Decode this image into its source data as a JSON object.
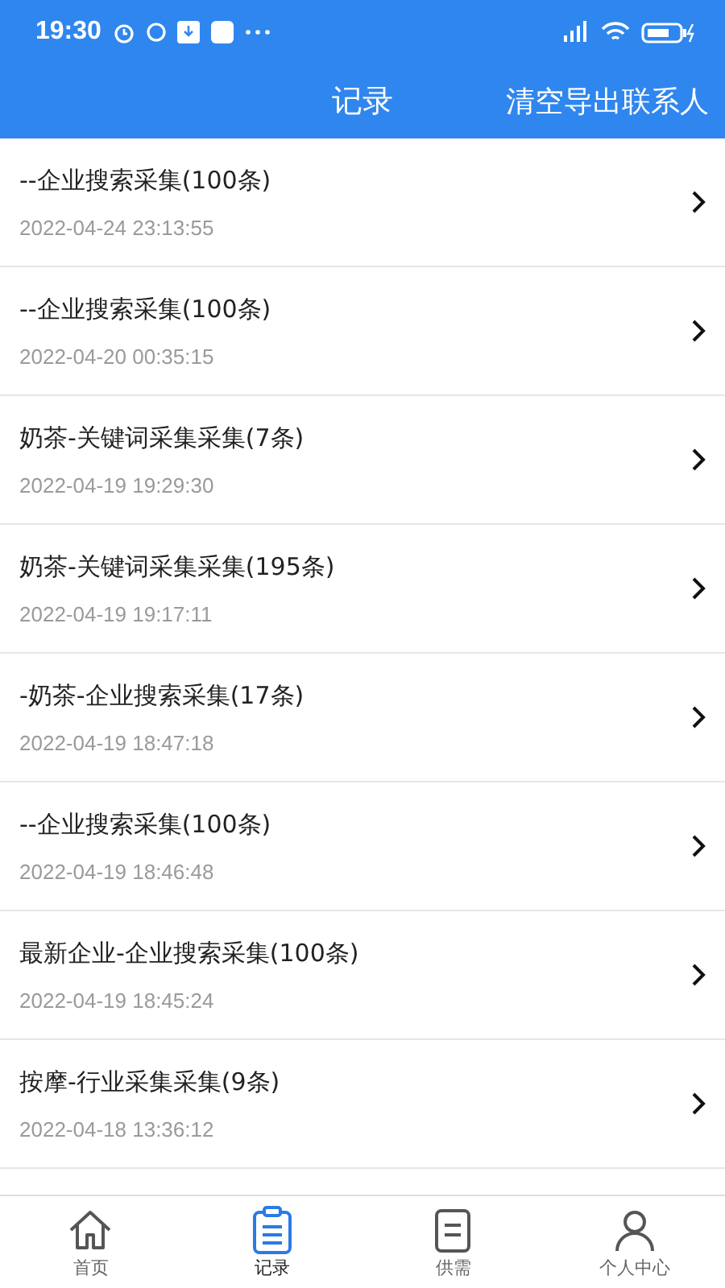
{
  "status_bar": {
    "time": "19:30"
  },
  "header": {
    "title": "记录",
    "action": "清空导出联系人"
  },
  "records": [
    {
      "title": "--企业搜索采集(100条)",
      "time": "2022-04-24 23:13:55"
    },
    {
      "title": "--企业搜索采集(100条)",
      "time": "2022-04-20 00:35:15"
    },
    {
      "title": "奶茶-关键词采集采集(7条)",
      "time": "2022-04-19 19:29:30"
    },
    {
      "title": "奶茶-关键词采集采集(195条)",
      "time": "2022-04-19 19:17:11"
    },
    {
      "title": "-奶茶-企业搜索采集(17条)",
      "time": "2022-04-19 18:47:18"
    },
    {
      "title": "--企业搜索采集(100条)",
      "time": "2022-04-19 18:46:48"
    },
    {
      "title": "最新企业-企业搜索采集(100条)",
      "time": "2022-04-19 18:45:24"
    },
    {
      "title": "按摩-行业采集采集(9条)",
      "time": "2022-04-18 13:36:12"
    }
  ],
  "tabs": [
    {
      "label": "首页",
      "kind": "home",
      "selected": false
    },
    {
      "label": "记录",
      "kind": "record",
      "selected": true
    },
    {
      "label": "供需",
      "kind": "supply",
      "selected": false
    },
    {
      "label": "个人中心",
      "kind": "profile",
      "selected": false
    }
  ]
}
